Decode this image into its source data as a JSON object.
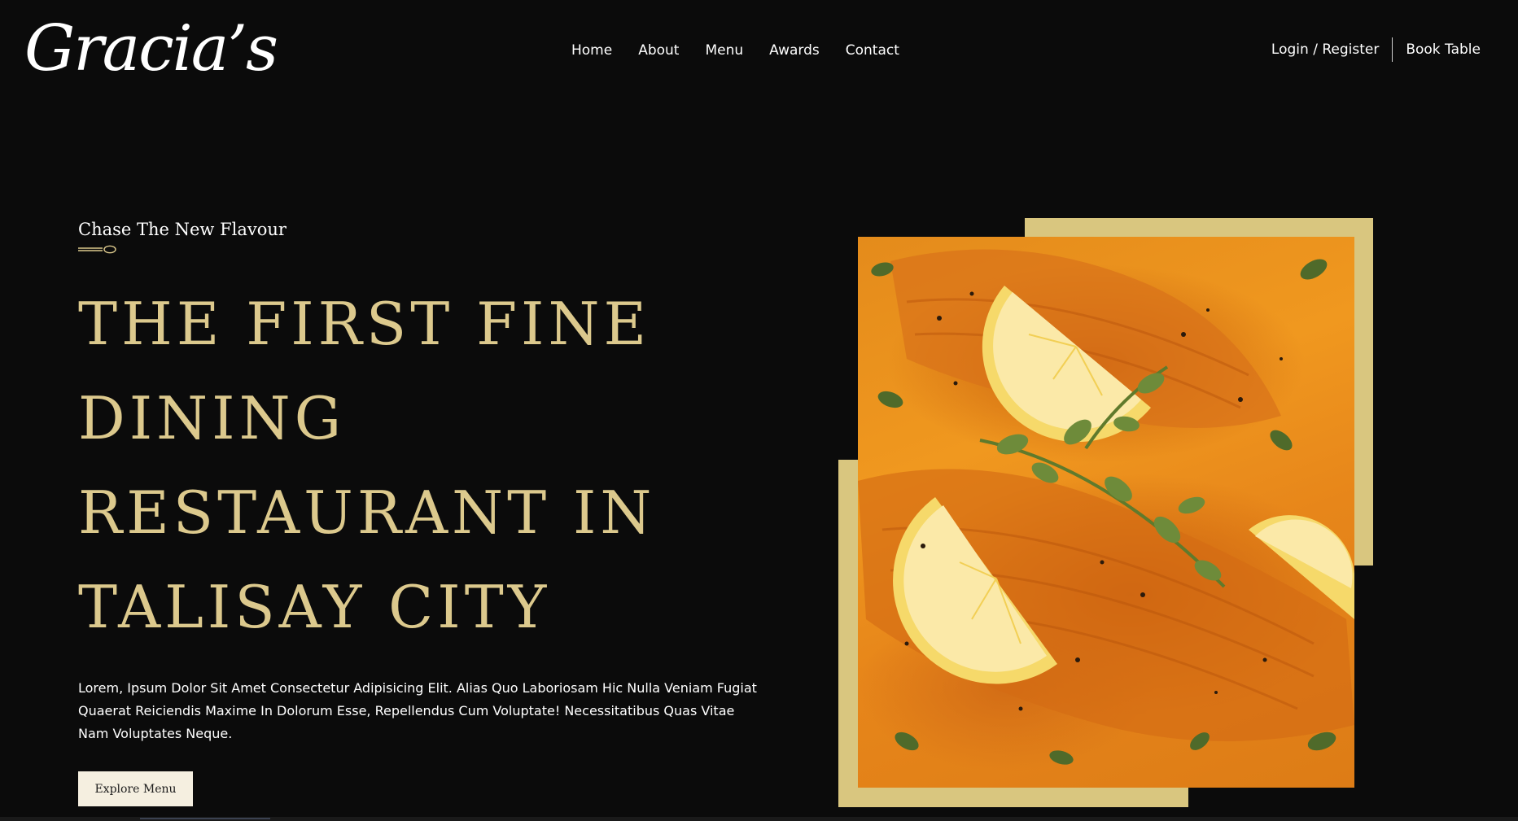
{
  "brand": {
    "logo_text": "Gracia’s"
  },
  "nav": {
    "items": [
      {
        "label": "Home"
      },
      {
        "label": "About"
      },
      {
        "label": "Menu"
      },
      {
        "label": "Awards"
      },
      {
        "label": "Contact"
      }
    ]
  },
  "auth": {
    "login_label": "Login / Register",
    "book_label": "Book Table"
  },
  "hero": {
    "tagline": "Chase The New Flavour",
    "headline": "THE FIRST FINE DINING RESTAURANT IN TALISAY CITY",
    "description": "Lorem, Ipsum Dolor Sit Amet Consectetur Adipisicing Elit. Alias Quo Laboriosam Hic Nulla Veniam Fugiat Quaerat Reiciendis Maxime In Dolorum Esse, Repellendus Cum Voluptate! Necessitatibus Quas Vitae Nam Voluptates Neque.",
    "button_label": "Explore Menu",
    "image_subject": "salmon-with-lemon-and-herbs"
  },
  "colors": {
    "background": "#0b0b0b",
    "accent_gold": "#dcc98d",
    "frame_gold": "#d9c67f",
    "button_bg": "#f5efe0",
    "text": "#ffffff"
  }
}
